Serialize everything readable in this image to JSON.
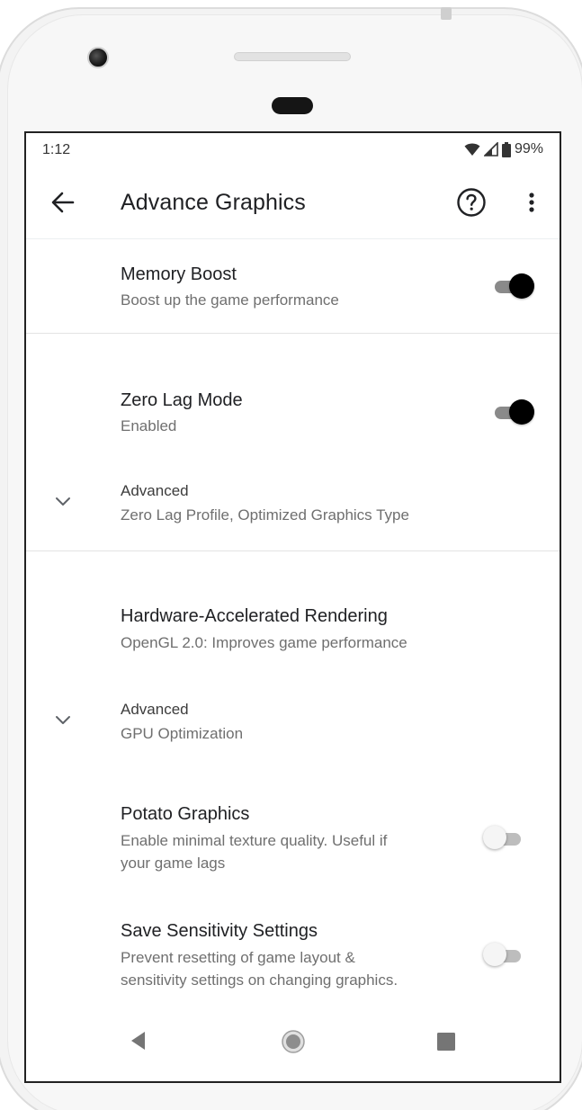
{
  "status_bar": {
    "time": "1:12",
    "battery": "99%",
    "icons": [
      "wifi-icon",
      "signal-icon",
      "battery-icon"
    ]
  },
  "app_bar": {
    "title": "Advance Graphics",
    "back_icon": "arrow-back-icon",
    "help_icon": "help-circle-icon",
    "more_icon": "more-vert-icon"
  },
  "preferences": {
    "memory_boost": {
      "title": "Memory Boost",
      "summary": "Boost up the game performance",
      "enabled": true
    },
    "zero_lag": {
      "title": "Zero Lag Mode",
      "summary": "Enabled",
      "enabled": true
    },
    "zero_lag_advanced": {
      "title": "Advanced",
      "summary": "Zero Lag Profile, Optimized Graphics Type"
    },
    "hw_rendering": {
      "title": "Hardware-Accelerated Rendering",
      "summary": "OpenGL 2.0: Improves game performance"
    },
    "hw_advanced": {
      "title": "Advanced",
      "summary": "GPU Optimization"
    },
    "potato_graphics": {
      "title": "Potato Graphics",
      "summary_line1": "Enable minimal texture quality. Useful if",
      "summary_line2": "your game lags",
      "enabled": false
    },
    "save_sensitivity": {
      "title": "Save Sensitivity Settings",
      "summary_line1": "Prevent resetting of game layout &",
      "summary_line2": "sensitivity settings on changing graphics.",
      "enabled": false
    }
  },
  "nav_bar": {
    "icons": [
      "nav-back-icon",
      "nav-home-icon",
      "nav-recents-icon"
    ]
  },
  "colors": {
    "switch_on_thumb": "#000000",
    "switch_on_track": "#8a8a8a",
    "switch_off_thumb": "#f5f5f5",
    "switch_off_track": "#bdbdbd"
  }
}
